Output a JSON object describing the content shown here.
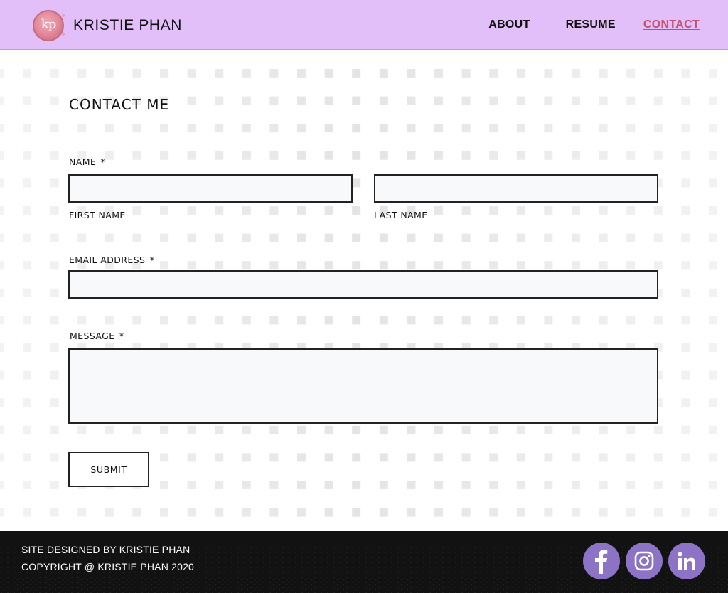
{
  "header": {
    "logo_text": "kp",
    "brand_name": "KRISTIE PHAN",
    "nav": {
      "about": "ABOUT",
      "resume": "RESUME",
      "contact": "CONTACT"
    }
  },
  "form": {
    "title": "CONTACT ME",
    "name_label": "NAME",
    "required_marker": "*",
    "first_name_label": "FIRST NAME",
    "last_name_label": "LAST NAME",
    "email_label": "EMAIL ADDRESS",
    "message_label": "MESSAGE",
    "first_name_value": "",
    "last_name_value": "",
    "email_value": "",
    "message_value": "",
    "submit_label": "SUBMIT"
  },
  "footer": {
    "designed_by": "SITE DESIGNED BY KRISTIE PHAN",
    "copyright": "COPYRIGHT @ KRISTIE PHAN 2020",
    "social": {
      "facebook_icon": "facebook-icon",
      "instagram_icon": "instagram-icon",
      "linkedin_icon": "linkedin-icon"
    }
  },
  "colors": {
    "header_bg": "#e2bff8",
    "accent": "#c0516f",
    "social_bg": "#8d73c6",
    "footer_bg": "#121212",
    "input_bg": "#f8f9fb",
    "pattern_square": "#e3e3e3"
  }
}
